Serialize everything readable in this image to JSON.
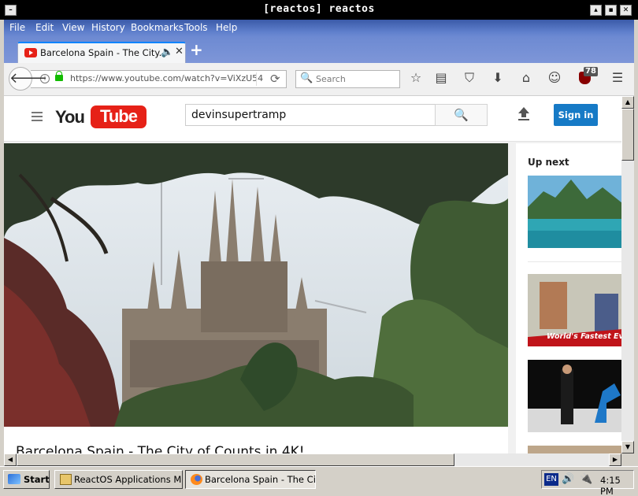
{
  "window": {
    "title": "[reactos] reactos",
    "buttons": {
      "minimize": "–",
      "restore": "▴",
      "maximize": "▪",
      "close": "✕"
    }
  },
  "menu": [
    "File",
    "Edit",
    "View",
    "History",
    "Bookmarks",
    "Tools",
    "Help"
  ],
  "tab": {
    "label": "Barcelona Spain - The City...",
    "new_tab": "+"
  },
  "navbar": {
    "url": "https://www.youtube.com/watch?v=ViXzU54",
    "search_placeholder": "Search",
    "ublock_count": "78"
  },
  "youtube": {
    "search_value": "devinsupertramp",
    "logo_you": "You",
    "logo_tube": "Tube",
    "sign_in": "Sign in",
    "video_title": "Barcelona Spain - The City of Counts in 4K!",
    "up_next": "Up next",
    "thumb2_caption": "World's Fastest Every"
  },
  "taskbar": {
    "start": "Start",
    "tasks": [
      "ReactOS Applications Man...",
      "Barcelona Spain - The City..."
    ],
    "lang": "EN",
    "clock": "4:15 PM"
  },
  "colors": {
    "accent": "#167ac6",
    "youtube_red": "#e62117",
    "menubar": "#3a5aa8"
  },
  "icons": [
    "back-arrow-icon",
    "info-icon",
    "lock-icon",
    "reload-icon",
    "search-icon",
    "bookmark-star-icon",
    "reading-list-icon",
    "pocket-icon",
    "download-icon",
    "home-icon",
    "emoji-icon",
    "ublock-icon",
    "hamburger-menu-icon",
    "upload-icon",
    "speaker-icon"
  ]
}
